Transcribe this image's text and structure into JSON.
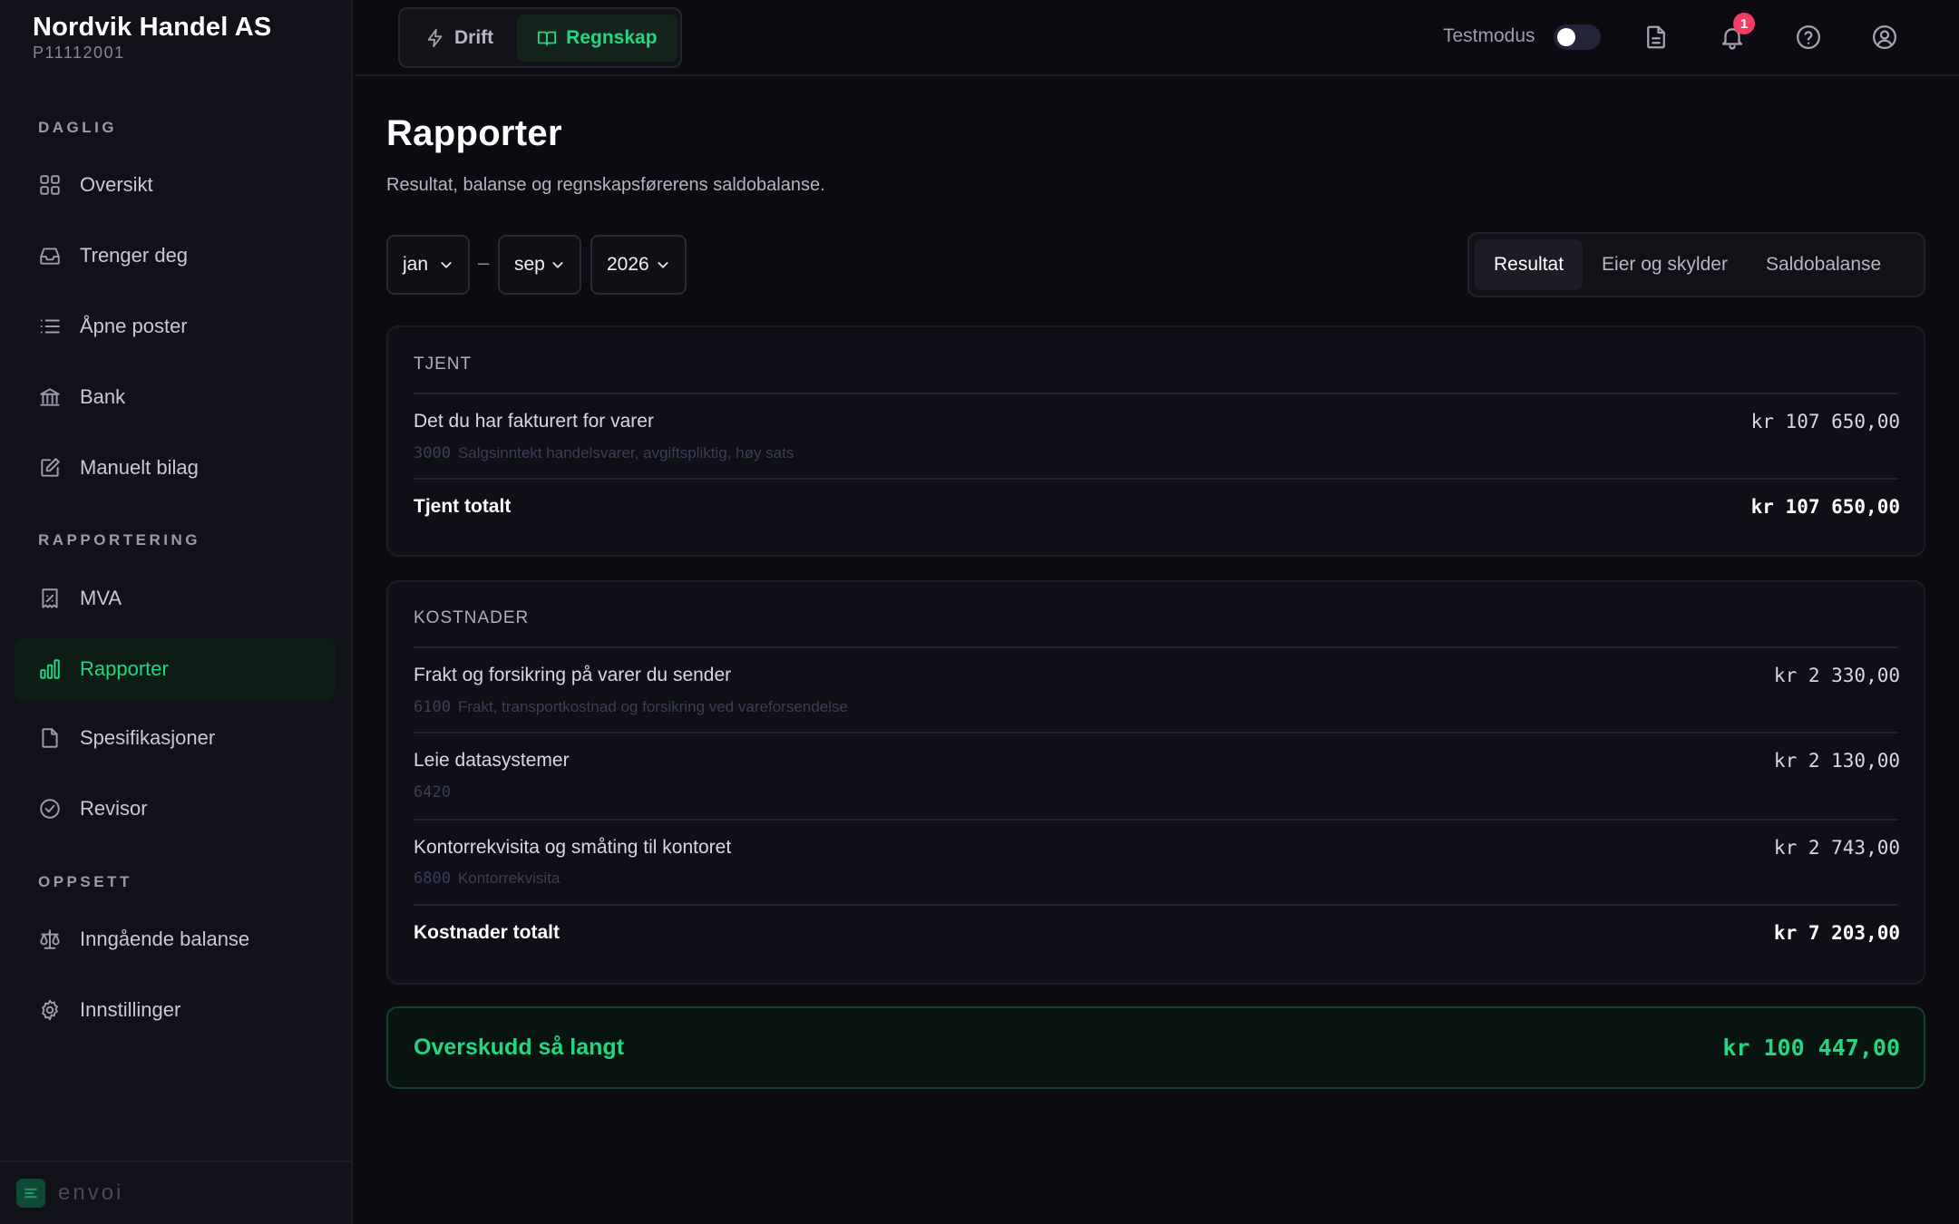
{
  "company": {
    "name": "Nordvik Handel AS",
    "id": "P11112001"
  },
  "sidebar": {
    "sections": [
      {
        "title": "DAGLIG"
      },
      {
        "title": "RAPPORTERING"
      },
      {
        "title": "OPPSETT"
      }
    ],
    "items": [
      {
        "label": "Oversikt",
        "icon": "grid-icon"
      },
      {
        "label": "Trenger deg",
        "icon": "inbox-icon"
      },
      {
        "label": "Åpne poster",
        "icon": "list-icon"
      },
      {
        "label": "Bank",
        "icon": "bank-icon"
      },
      {
        "label": "Manuelt bilag",
        "icon": "edit-icon"
      },
      {
        "label": "MVA",
        "icon": "receipt-percent-icon"
      },
      {
        "label": "Rapporter",
        "icon": "bar-chart-icon",
        "active": true
      },
      {
        "label": "Spesifikasjoner",
        "icon": "document-icon"
      },
      {
        "label": "Revisor",
        "icon": "check-circle-icon"
      },
      {
        "label": "Inngående balanse",
        "icon": "scale-icon"
      },
      {
        "label": "Innstillinger",
        "icon": "gear-icon"
      }
    ],
    "footer": {
      "label": "envoi"
    }
  },
  "topbar": {
    "modes": [
      {
        "label": "Drift",
        "icon": "lightning-icon"
      },
      {
        "label": "Regnskap",
        "icon": "open-book-icon",
        "active": true
      }
    ],
    "testmodus_label": "Testmodus",
    "testmodus_on": false,
    "notification_count": "1"
  },
  "page": {
    "title": "Rapporter",
    "subtitle": "Resultat, balanse og regnskapsførerens saldobalanse."
  },
  "filters": {
    "from_month": "jan",
    "range_separator": "–",
    "to_month": "sep",
    "year": "2026"
  },
  "report_tabs": [
    {
      "label": "Resultat",
      "active": true
    },
    {
      "label": "Eier og skylder"
    },
    {
      "label": "Saldobalanse"
    }
  ],
  "income": {
    "header": "TJENT",
    "rows": [
      {
        "label": "Det du har fakturert for varer",
        "account": "3000",
        "account_name": "Salgsinntekt handelsvarer, avgiftspliktig, høy sats",
        "amount": "kr 107 650,00"
      }
    ],
    "total_label": "Tjent totalt",
    "total_amount": "kr 107 650,00"
  },
  "costs": {
    "header": "KOSTNADER",
    "rows": [
      {
        "label": "Frakt og forsikring på varer du sender",
        "account": "6100",
        "account_name": "Frakt, transportkostnad og forsikring ved vareforsendelse",
        "amount": "kr 2 330,00"
      },
      {
        "label": "Leie datasystemer",
        "account": "6420",
        "account_name": "",
        "amount": "kr 2 130,00"
      },
      {
        "label": "Kontorrekvisita og småting til kontoret",
        "account": "6800",
        "account_name": "Kontorrekvisita",
        "amount": "kr 2 743,00"
      }
    ],
    "total_label": "Kostnader totalt",
    "total_amount": "kr 7 203,00"
  },
  "result": {
    "label": "Overskudd så langt",
    "amount": "kr 100 447,00"
  },
  "colors": {
    "accent": "#22d682",
    "background": "#0b0b11",
    "badge": "#f23d63"
  }
}
